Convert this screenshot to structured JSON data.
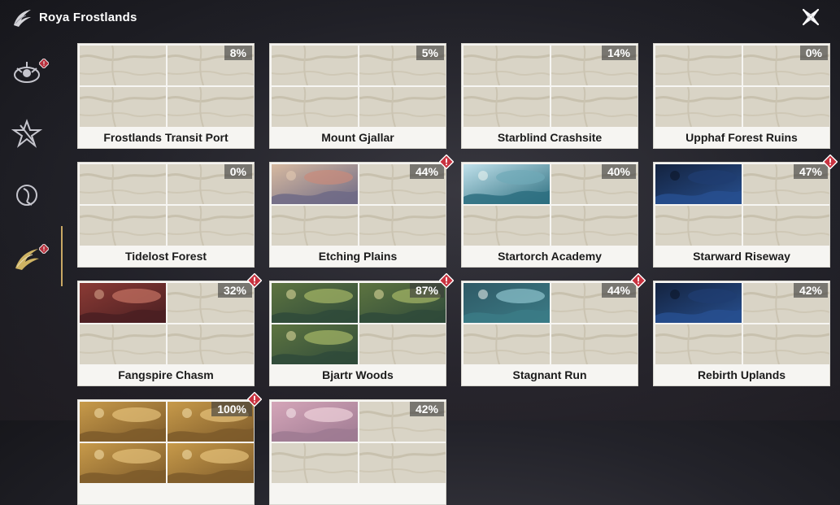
{
  "header": {
    "title": "Roya Frostlands"
  },
  "sidebar": {
    "items": [
      {
        "name": "faction-crest-1",
        "alert": true
      },
      {
        "name": "faction-crest-2",
        "alert": false
      },
      {
        "name": "faction-crest-3",
        "alert": false
      },
      {
        "name": "faction-crest-4",
        "alert": true,
        "active": true
      }
    ]
  },
  "locations": [
    {
      "name": "Frostlands Transit Port",
      "progress": "8%",
      "alert": false,
      "revealed": [
        false,
        false,
        false,
        false
      ]
    },
    {
      "name": "Mount Gjallar",
      "progress": "5%",
      "alert": false,
      "revealed": [
        false,
        false,
        false,
        false
      ]
    },
    {
      "name": "Starblind Crashsite",
      "progress": "14%",
      "alert": false,
      "revealed": [
        false,
        false,
        false,
        false
      ]
    },
    {
      "name": "Upphaf Forest Ruins",
      "progress": "0%",
      "alert": false,
      "revealed": [
        false,
        false,
        false,
        false
      ]
    },
    {
      "name": "Tidelost Forest",
      "progress": "0%",
      "alert": false,
      "revealed": [
        false,
        false,
        false,
        false
      ]
    },
    {
      "name": "Etching Plains",
      "progress": "44%",
      "alert": true,
      "revealed": [
        true,
        false,
        false,
        false
      ],
      "scene": "sunset"
    },
    {
      "name": "Startorch Academy",
      "progress": "40%",
      "alert": false,
      "revealed": [
        true,
        false,
        false,
        false
      ],
      "scene": "academy"
    },
    {
      "name": "Starward Riseway",
      "progress": "47%",
      "alert": true,
      "revealed": [
        true,
        false,
        false,
        false
      ],
      "scene": "night"
    },
    {
      "name": "Fangspire Chasm",
      "progress": "32%",
      "alert": true,
      "revealed": [
        true,
        false,
        false,
        false
      ],
      "scene": "crimson"
    },
    {
      "name": "Bjartr Woods",
      "progress": "87%",
      "alert": true,
      "revealed": [
        true,
        true,
        true,
        false
      ],
      "scene": "forest"
    },
    {
      "name": "Stagnant Run",
      "progress": "44%",
      "alert": true,
      "revealed": [
        true,
        false,
        false,
        false
      ],
      "scene": "teal"
    },
    {
      "name": "Rebirth Uplands",
      "progress": "42%",
      "alert": false,
      "revealed": [
        true,
        false,
        false,
        false
      ],
      "scene": "night"
    },
    {
      "name": "",
      "progress": "100%",
      "alert": true,
      "revealed": [
        true,
        true,
        true,
        true
      ],
      "scene": "gold"
    },
    {
      "name": "",
      "progress": "42%",
      "alert": false,
      "revealed": [
        true,
        false,
        false,
        false
      ],
      "scene": "pink"
    }
  ],
  "colors": {
    "accent": "#c9a864",
    "alert": "#c8323f",
    "card": "#f6f5f2",
    "unexplored": "#d9d4c6"
  }
}
